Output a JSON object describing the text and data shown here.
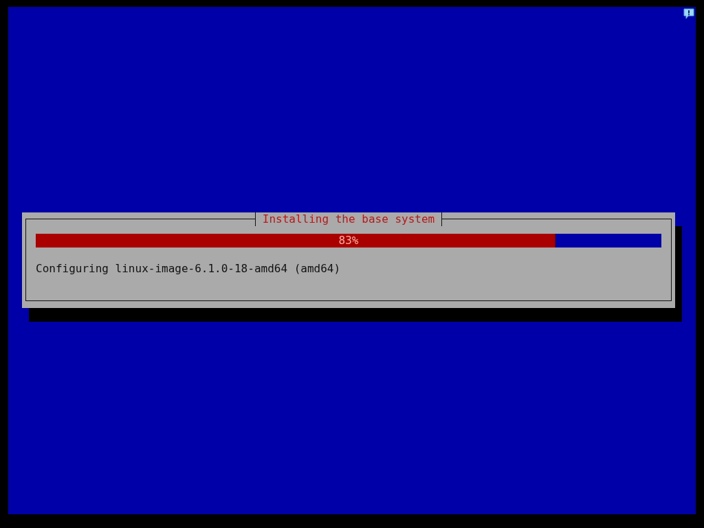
{
  "dialog": {
    "title": "Installing the base system",
    "progress": {
      "level": 0.83,
      "label": "83%"
    },
    "message": "Configuring linux-image-6.1.0-18-amd64 (amd64)"
  }
}
